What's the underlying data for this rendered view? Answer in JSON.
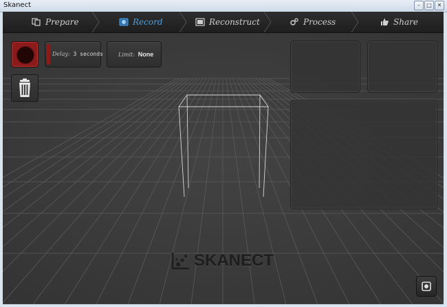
{
  "window": {
    "title": "Skanect",
    "controls": {
      "minimize": "–",
      "maximize": "□",
      "close": "✕"
    }
  },
  "tabs": [
    {
      "label": "Prepare",
      "icon": "prepare-icon",
      "active": false
    },
    {
      "label": "Record",
      "icon": "record-icon",
      "active": true
    },
    {
      "label": "Reconstruct",
      "icon": "film-icon",
      "active": false
    },
    {
      "label": "Process",
      "icon": "gears-icon",
      "active": false
    },
    {
      "label": "Share",
      "icon": "thumbs-up-icon",
      "active": false
    }
  ],
  "record": {
    "delay_label": "Delay:",
    "delay_value": "3 seconds",
    "limit_label": "Limit:",
    "limit_value": "None"
  },
  "logo": {
    "text": "SKANECT"
  },
  "colors": {
    "active_tab": "#4a9fe0",
    "record_red": "#8b1a1a",
    "background": "#3a3a3a"
  }
}
